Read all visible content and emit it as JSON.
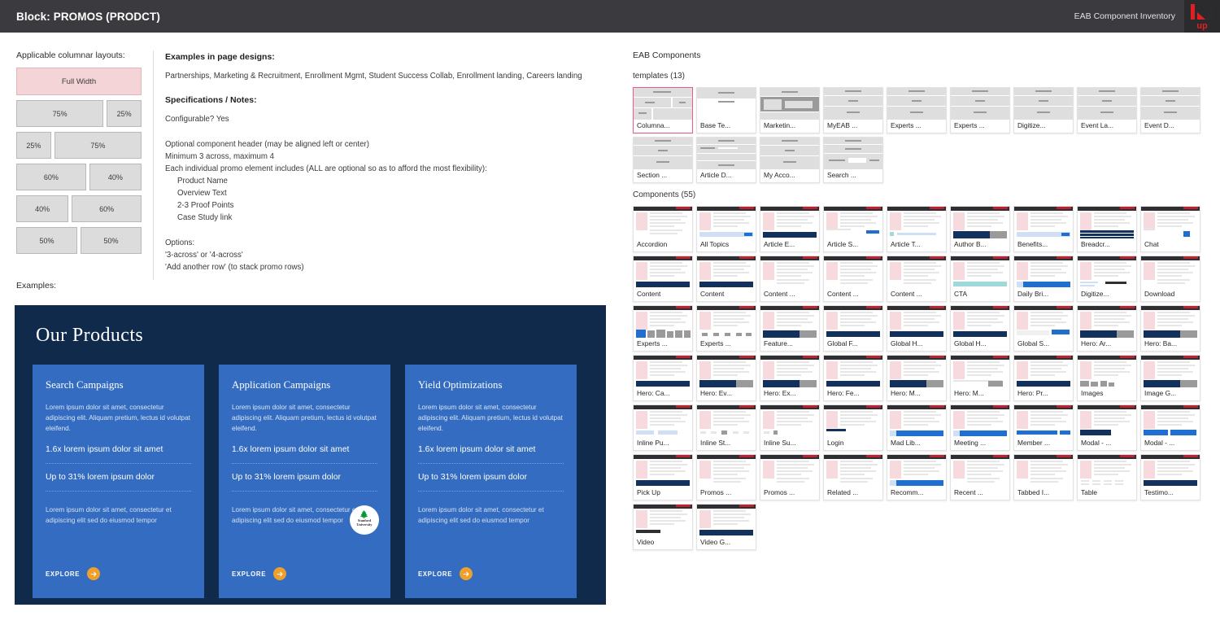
{
  "topbar": {
    "title": "Block: PROMOS (PRODCT)",
    "subtitle": "EAB Component Inventory",
    "logo_alt": "10up",
    "bg": "#3b3b3f",
    "logo_color": "#e02020"
  },
  "left": {
    "heading": "Applicable columnar layouts:",
    "examples_label": "Examples:",
    "layouts": [
      [
        {
          "label": "Full Width",
          "selected": true
        }
      ],
      [
        {
          "label": "75%"
        },
        {
          "label": "25%"
        }
      ],
      [
        {
          "label": "25%"
        },
        {
          "label": "75%"
        }
      ],
      [
        {
          "label": "60%"
        },
        {
          "label": "40%"
        }
      ],
      [
        {
          "label": "40%"
        },
        {
          "label": "60%"
        }
      ],
      [
        {
          "label": "50%"
        },
        {
          "label": "50%"
        }
      ]
    ],
    "selected_color": "#f5d4d7"
  },
  "spec": {
    "examples_heading": "Examples in page designs:",
    "examples_body": "Partnerships, Marketing & Recruitment, Enrollment Mgmt, Student Success Collab, Enrollment landing, Careers landing",
    "notes_heading": "Specifications / Notes:",
    "configurable": "Configurable? Yes",
    "notes": [
      "Optional component header (may be aligned left or center)",
      "Minimum 3 across, maximum 4",
      "Each individual promo element includes (ALL are optional so as to afford the most flexibility):"
    ],
    "bullets": [
      "Product Name",
      "Overview Text",
      "2-3 Proof Points",
      "Case Study link"
    ],
    "options_heading": "Options:",
    "options": [
      "'3-across' or '4-across'",
      "'Add another row' (to stack promo rows)"
    ]
  },
  "promo": {
    "title": "Our Products",
    "bg": "#102a4c",
    "card_bg": "#336cc0",
    "accent": "#f0a02a",
    "cards": [
      {
        "title": "Search Campaigns",
        "blurb": "Lorem ipsum dolor sit amet, consectetur adipiscing elit. Aliquam pretium, lectus id volutpat eleifend.",
        "proof1": "1.6x lorem ipsum dolor sit amet",
        "proof2": "Up to 31% lorem ipsum dolor",
        "foot": "Lorem ipsum dolor sit amet, consectetur et adipiscing elit sed do eiusmod tempor",
        "cta": "EXPLORE",
        "badge": null
      },
      {
        "title": "Application Campaigns",
        "blurb": "Lorem ipsum dolor sit amet, consectetur adipiscing elit. Aliquam pretium, lectus id volutpat eleifend.",
        "proof1": "1.6x lorem ipsum dolor sit amet",
        "proof2": "Up to 31% lorem ipsum dolor",
        "foot": "Lorem ipsum dolor sit amet, consectetur et adipiscing elit sed do eiusmod tempor",
        "cta": "EXPLORE",
        "badge": {
          "line1": "Stanford",
          "line2": "University"
        }
      },
      {
        "title": "Yield Optimizations",
        "blurb": "Lorem ipsum dolor sit amet, consectetur adipiscing elit. Aliquam pretium, lectus id volutpat eleifend.",
        "proof1": "1.6x lorem ipsum dolor sit amet",
        "proof2": "Up to 31% lorem ipsum dolor",
        "foot": "Lorem ipsum dolor sit amet, consectetur et adipiscing elit sed do eiusmod tempor",
        "cta": "EXPLORE",
        "badge": null
      }
    ]
  },
  "right": {
    "title": "EAB Components",
    "templates_label": "templates (13)",
    "components_label": "Components (55)",
    "selected_color": "#e8607f",
    "templates": [
      {
        "label": "Columna...",
        "selected": true,
        "style": "tpl-columnar"
      },
      {
        "label": "Base Te...",
        "style": "tpl-base"
      },
      {
        "label": "Marketin...",
        "style": "tpl-marketing"
      },
      {
        "label": "MyEAB ...",
        "style": "tpl-plain"
      },
      {
        "label": "Experts ...",
        "style": "tpl-plain"
      },
      {
        "label": "Experts ...",
        "style": "tpl-plain"
      },
      {
        "label": "Digitize...",
        "style": "tpl-plain"
      },
      {
        "label": "Event La...",
        "style": "tpl-plain"
      },
      {
        "label": "Event D...",
        "style": "tpl-plain"
      },
      {
        "label": "Section ...",
        "style": "tpl-plain"
      },
      {
        "label": "Article D...",
        "style": "tpl-article"
      },
      {
        "label": "My Acco...",
        "style": "tpl-plain"
      },
      {
        "label": "Search ...",
        "style": "tpl-search"
      }
    ],
    "components": [
      {
        "label": "Accordion",
        "style": "cmp-plain"
      },
      {
        "label": "All Topics",
        "style": "cmp-ltblue"
      },
      {
        "label": "Article E...",
        "style": "cmp-navy"
      },
      {
        "label": "Article S...",
        "style": "cmp-form"
      },
      {
        "label": "Article T...",
        "style": "cmp-thumbs"
      },
      {
        "label": "Author B...",
        "style": "cmp-navyimg"
      },
      {
        "label": "Benefits...",
        "style": "cmp-ltblue"
      },
      {
        "label": "Breadcr...",
        "style": "cmp-stripes"
      },
      {
        "label": "Chat",
        "style": "cmp-chat"
      },
      {
        "label": "Content",
        "style": "cmp-navy"
      },
      {
        "label": "Content",
        "style": "cmp-navy"
      },
      {
        "label": "Content ...",
        "style": "cmp-plain"
      },
      {
        "label": "Content ...",
        "style": "cmp-plain"
      },
      {
        "label": "Content ...",
        "style": "cmp-plain"
      },
      {
        "label": "CTA",
        "style": "cmp-teal"
      },
      {
        "label": "Daily Bri...",
        "style": "cmp-blue"
      },
      {
        "label": "Digitize...",
        "style": "cmp-bars"
      },
      {
        "label": "Download",
        "style": "cmp-plain"
      },
      {
        "label": "Experts ...",
        "style": "cmp-avatars"
      },
      {
        "label": "Experts ...",
        "style": "cmp-faces"
      },
      {
        "label": "Feature...",
        "style": "cmp-navyimg"
      },
      {
        "label": "Global F...",
        "style": "cmp-navy"
      },
      {
        "label": "Global H...",
        "style": "cmp-navy"
      },
      {
        "label": "Global H...",
        "style": "cmp-navy"
      },
      {
        "label": "Global S...",
        "style": "cmp-search"
      },
      {
        "label": "Hero: Ar...",
        "style": "cmp-navyimg"
      },
      {
        "label": "Hero: Ba...",
        "style": "cmp-navyimg"
      },
      {
        "label": "Hero: Ca...",
        "style": "cmp-navy"
      },
      {
        "label": "Hero: Ev...",
        "style": "cmp-navyimg"
      },
      {
        "label": "Hero: Ex...",
        "style": "cmp-navyimg"
      },
      {
        "label": "Hero: Fe...",
        "style": "cmp-navy"
      },
      {
        "label": "Hero: M...",
        "style": "cmp-navyimg"
      },
      {
        "label": "Hero: M...",
        "style": "cmp-photo"
      },
      {
        "label": "Hero: Pr...",
        "style": "cmp-navy"
      },
      {
        "label": "Images",
        "style": "cmp-images"
      },
      {
        "label": "Image G...",
        "style": "cmp-navyimg"
      },
      {
        "label": "Inline Pu...",
        "style": "cmp-pills"
      },
      {
        "label": "Inline St...",
        "style": "cmp-stats"
      },
      {
        "label": "Inline Su...",
        "style": "cmp-small"
      },
      {
        "label": "Login",
        "style": "cmp-login"
      },
      {
        "label": "Mad Lib...",
        "style": "cmp-blue"
      },
      {
        "label": "Meeting ...",
        "style": "cmp-blue"
      },
      {
        "label": "Member ...",
        "style": "cmp-bluebar"
      },
      {
        "label": "Modal - ...",
        "style": "cmp-modal"
      },
      {
        "label": "Modal - ...",
        "style": "cmp-modal2"
      },
      {
        "label": "Pick Up",
        "style": "cmp-navy"
      },
      {
        "label": "Promos ...",
        "style": "cmp-plain"
      },
      {
        "label": "Promos ...",
        "style": "cmp-plain"
      },
      {
        "label": "Related ...",
        "style": "cmp-plain"
      },
      {
        "label": "Recomm...",
        "style": "cmp-blue"
      },
      {
        "label": "Recent ...",
        "style": "cmp-plain"
      },
      {
        "label": "Tabbed I...",
        "style": "cmp-plain"
      },
      {
        "label": "Table",
        "style": "cmp-table"
      },
      {
        "label": "Testimo...",
        "style": "cmp-navy"
      },
      {
        "label": "Video",
        "style": "cmp-video"
      },
      {
        "label": "Video G...",
        "style": "cmp-navy"
      }
    ]
  }
}
